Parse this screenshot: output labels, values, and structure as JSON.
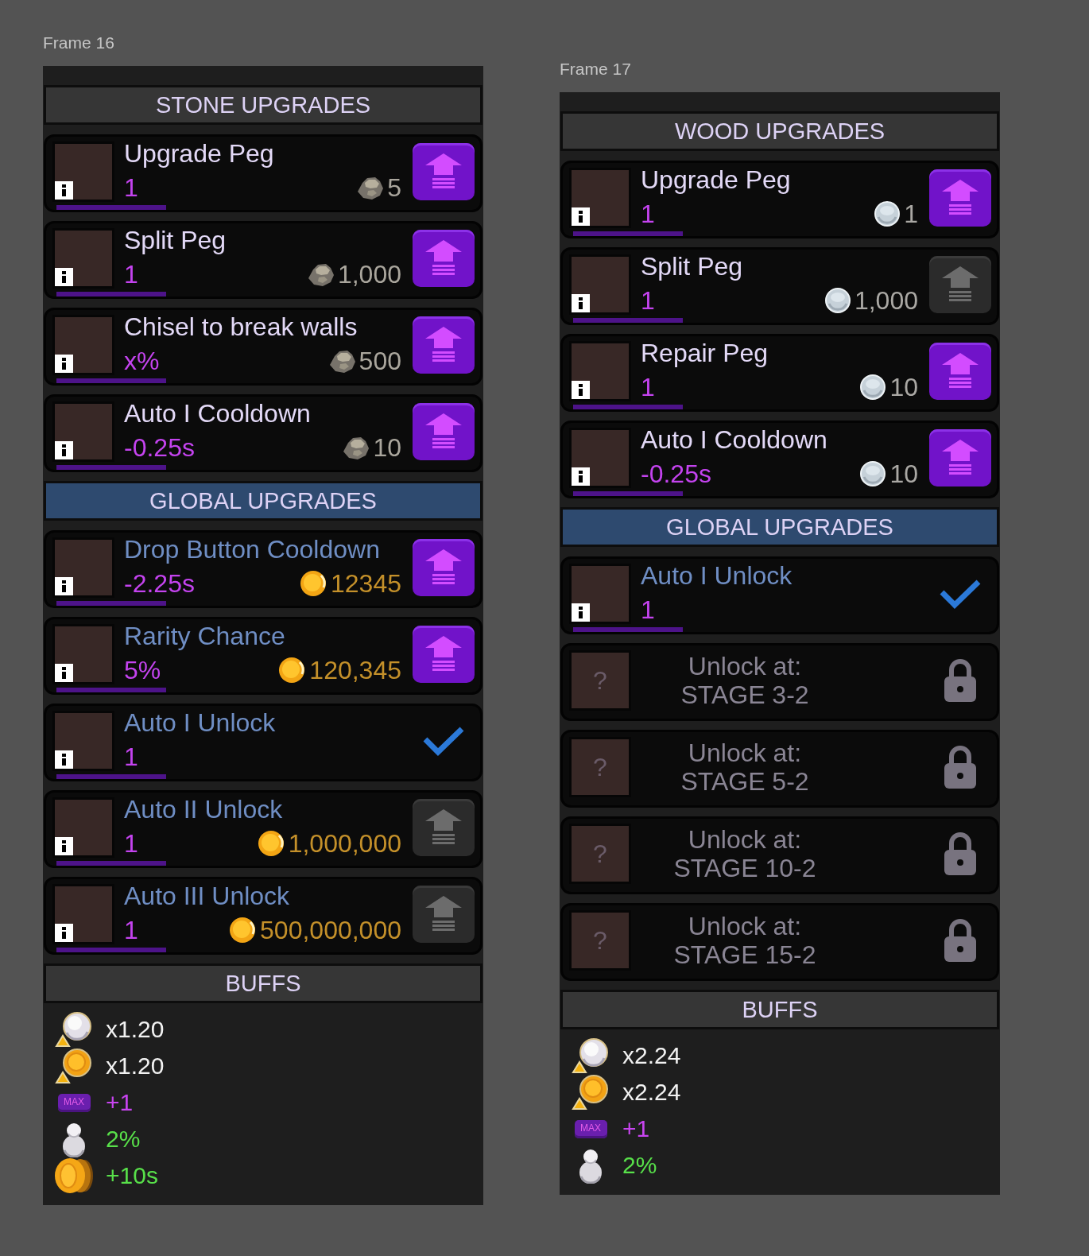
{
  "frames": [
    {
      "label": "Frame 16",
      "sections": [
        {
          "kind": "resource",
          "title": "STONE UPGRADES",
          "rows": [
            {
              "kind": "upgrade",
              "title": "Upgrade Peg",
              "value": "1",
              "cost": {
                "kind": "stone",
                "amount": "5"
              },
              "disabled": false
            },
            {
              "kind": "upgrade",
              "title": "Split Peg",
              "value": "1",
              "cost": {
                "kind": "stone",
                "amount": "1,000"
              },
              "disabled": false
            },
            {
              "kind": "upgrade",
              "title": "Chisel to break walls",
              "value": "x%",
              "cost": {
                "kind": "stone",
                "amount": "500"
              },
              "disabled": false
            },
            {
              "kind": "upgrade",
              "title": "Auto I Cooldown",
              "value": "-0.25s",
              "cost": {
                "kind": "stone",
                "amount": "10"
              },
              "disabled": false
            }
          ]
        },
        {
          "kind": "global",
          "title": "GLOBAL UPGRADES",
          "rows": [
            {
              "kind": "upgrade",
              "title": "Drop Button Cooldown",
              "value": "-2.25s",
              "cost": {
                "kind": "coin",
                "amount": "12345"
              },
              "disabled": false
            },
            {
              "kind": "upgrade",
              "title": "Rarity Chance",
              "value": "5%",
              "cost": {
                "kind": "coin",
                "amount": "120,345"
              },
              "disabled": false
            },
            {
              "kind": "unlocked",
              "title": "Auto I Unlock",
              "value": "1"
            },
            {
              "kind": "upgrade",
              "title": "Auto II Unlock",
              "value": "1",
              "cost": {
                "kind": "coin",
                "amount": "1,000,000"
              },
              "disabled": true
            },
            {
              "kind": "upgrade",
              "title": "Auto III Unlock",
              "value": "1",
              "cost": {
                "kind": "coin",
                "amount": "500,000,000"
              },
              "disabled": true
            }
          ]
        }
      ],
      "buffs": {
        "title": "BUFFS",
        "items": [
          {
            "kind": "ball-boost",
            "value": "x1.20"
          },
          {
            "kind": "coin-boost",
            "value": "x1.20"
          },
          {
            "kind": "max",
            "badge": "MAX",
            "value": "+1"
          },
          {
            "kind": "split",
            "value": "2%"
          },
          {
            "kind": "coin-time",
            "value": "+10s"
          }
        ]
      }
    },
    {
      "label": "Frame 17",
      "sections": [
        {
          "kind": "resource",
          "title": "WOOD UPGRADES",
          "rows": [
            {
              "kind": "upgrade",
              "title": "Upgrade Peg",
              "value": "1",
              "cost": {
                "kind": "silver",
                "amount": "1"
              },
              "disabled": false
            },
            {
              "kind": "upgrade",
              "title": "Split Peg",
              "value": "1",
              "cost": {
                "kind": "silver",
                "amount": "1,000"
              },
              "disabled": true
            },
            {
              "kind": "upgrade",
              "title": "Repair Peg",
              "value": "1",
              "cost": {
                "kind": "silver",
                "amount": "10"
              },
              "disabled": false
            },
            {
              "kind": "upgrade",
              "title": "Auto I Cooldown",
              "value": "-0.25s",
              "cost": {
                "kind": "silver",
                "amount": "10"
              },
              "disabled": false
            }
          ]
        },
        {
          "kind": "global",
          "title": "GLOBAL UPGRADES",
          "rows": [
            {
              "kind": "unlocked",
              "title": "Auto I Unlock",
              "value": "1"
            },
            {
              "kind": "locked",
              "glyph": "?",
              "label": "Unlock at:",
              "stage": "STAGE 3-2"
            },
            {
              "kind": "locked",
              "glyph": "?",
              "label": "Unlock at:",
              "stage": "STAGE 5-2"
            },
            {
              "kind": "locked",
              "glyph": "?",
              "label": "Unlock at:",
              "stage": "STAGE 10-2"
            },
            {
              "kind": "locked",
              "glyph": "?",
              "label": "Unlock at:",
              "stage": "STAGE 15-2"
            }
          ]
        }
      ],
      "buffs": {
        "title": "BUFFS",
        "items": [
          {
            "kind": "ball-boost",
            "value": "x2.24"
          },
          {
            "kind": "coin-boost",
            "value": "x2.24"
          },
          {
            "kind": "max",
            "badge": "MAX",
            "value": "+1"
          },
          {
            "kind": "split",
            "value": "2%"
          }
        ]
      }
    }
  ]
}
